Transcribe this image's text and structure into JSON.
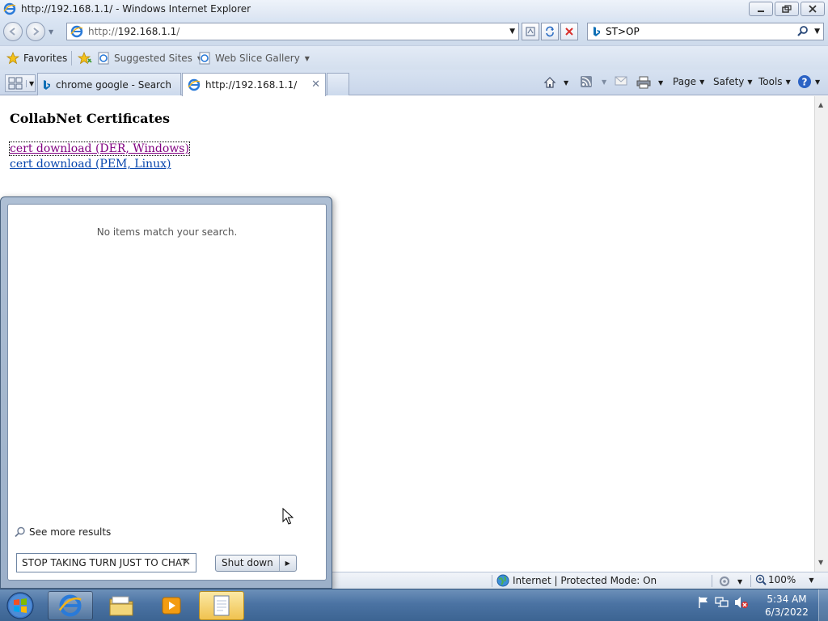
{
  "window": {
    "title": "http://192.168.1.1/ - Windows Internet Explorer"
  },
  "address_bar": {
    "protocol": "http://",
    "host": "192.168.1.1",
    "path": "/"
  },
  "search_bar": {
    "value": "ST>OP"
  },
  "favorites_bar": {
    "favorites_label": "Favorites",
    "suggested_sites_label": "Suggested Sites",
    "web_slice_gallery_label": "Web Slice Gallery"
  },
  "tabs": [
    {
      "label": "chrome google - Search",
      "active": false
    },
    {
      "label": "http://192.168.1.1/",
      "active": true
    }
  ],
  "command_bar": {
    "page_label": "Page",
    "safety_label": "Safety",
    "tools_label": "Tools"
  },
  "page": {
    "heading": "CollabNet Certificates",
    "links": [
      {
        "text": "cert download (DER, Windows)",
        "visited": true
      },
      {
        "text": "cert download (PEM, Linux)",
        "visited": false
      }
    ]
  },
  "status_bar": {
    "zone_text": "Internet | Protected Mode: On",
    "zoom": "100%"
  },
  "start_menu": {
    "no_results_text": "No items match your search.",
    "see_more_label": "See more results",
    "search_value": "STOP TAKING TURN JUST TO CHAT",
    "shutdown_label": "Shut down"
  },
  "taskbar": {
    "time": "5:34 AM",
    "date": "6/3/2022"
  },
  "colors": {
    "link_visited": "#800080",
    "link_unvisited": "#0645ad",
    "taskbar": "#4b73a3",
    "close_red": "#d9302c"
  }
}
